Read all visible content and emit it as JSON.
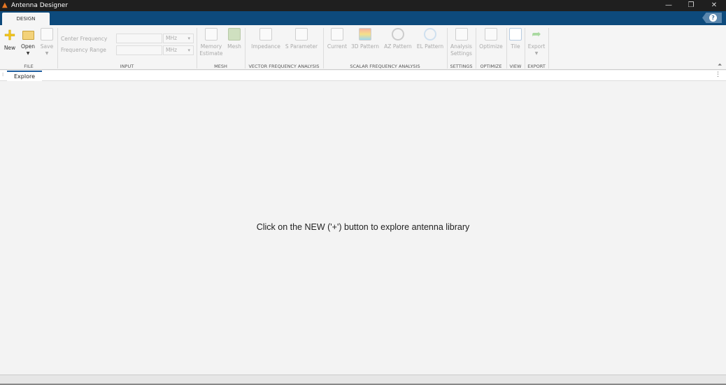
{
  "window": {
    "title": "Antenna Designer",
    "minimize": "—",
    "restore": "❐",
    "close": "✕"
  },
  "tabs": {
    "design": "DESIGN",
    "help": "?"
  },
  "file": {
    "section": "FILE",
    "new": "New",
    "open": "Open",
    "save": "Save"
  },
  "input": {
    "section": "INPUT",
    "center_frequency": "Center Frequency",
    "frequency_range": "Frequency Range",
    "center_unit": "MHz",
    "range_unit": "MHz",
    "center_value": "",
    "range_value": ""
  },
  "mesh": {
    "section": "MESH",
    "memory": "Memory",
    "estimate": "Estimate",
    "mesh": "Mesh"
  },
  "vfa": {
    "section": "VECTOR FREQUENCY ANALYSIS",
    "impedance": "Impedance",
    "sparam": "S Parameter"
  },
  "sfa": {
    "section": "SCALAR FREQUENCY ANALYSIS",
    "current": "Current",
    "pattern3d": "3D Pattern",
    "az": "AZ Pattern",
    "el": "EL Pattern"
  },
  "settings": {
    "section": "SETTINGS",
    "analysis": "Analysis",
    "settings": "Settings"
  },
  "optimize": {
    "section": "OPTIMIZE",
    "optimize": "Optimize"
  },
  "view": {
    "section": "VIEW",
    "tile": "Tile"
  },
  "export": {
    "section": "EXPORT",
    "export": "Export"
  },
  "doc": {
    "tab": "Explore",
    "message": "Click on the NEW ('+') button to explore antenna library"
  }
}
